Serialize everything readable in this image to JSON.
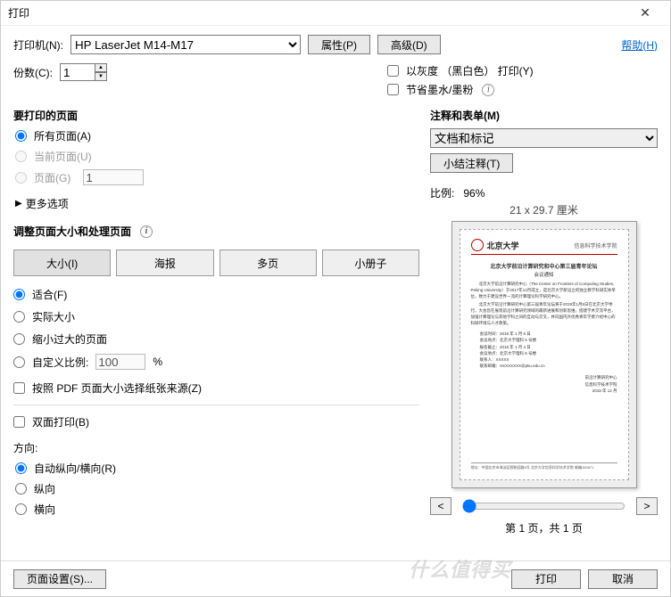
{
  "titlebar": {
    "title": "打印"
  },
  "header": {
    "printer_label": "打印机(N):",
    "printer_selected": "HP LaserJet M14-M17",
    "properties_btn": "属性(P)",
    "advanced_btn": "高级(D)",
    "help_link": "帮助(H)"
  },
  "copies": {
    "label": "份数(C):",
    "value": "1"
  },
  "options": {
    "grayscale": "以灰度 （黑白色） 打印(Y)",
    "save_ink": "节省墨水/墨粉"
  },
  "pages_section": {
    "title": "要打印的页面",
    "all": "所有页面(A)",
    "current": "当前页面(U)",
    "page_label": "页面(G)",
    "page_from_value": "1",
    "more": "更多选项"
  },
  "resize_section": {
    "title": "调整页面大小和处理页面",
    "tabs": {
      "size": "大小(I)",
      "poster": "海报",
      "multi": "多页",
      "booklet": "小册子"
    },
    "fit": "适合(F)",
    "actual": "实际大小",
    "shrink": "缩小过大的页面",
    "custom": "自定义比例:",
    "custom_value": "100",
    "percent": "%",
    "choose_source": "按照 PDF 页面大小选择纸张来源(Z)"
  },
  "duplex": {
    "label": "双面打印(B)"
  },
  "orientation": {
    "label": "方向:",
    "auto": "自动纵向/横向(R)",
    "portrait": "纵向",
    "landscape": "横向"
  },
  "comments": {
    "title": "注释和表单(M)",
    "dropdown_selected": "文档和标记",
    "summarize_btn": "小结注释(T)"
  },
  "preview": {
    "scale_label": "比例:",
    "scale_value": "96%",
    "dimensions": "21 x 29.7 厘米",
    "page_indicator": "第 1 页，共 1 页",
    "doc": {
      "university": "北京大学",
      "institute": "信息科学技术学院",
      "title": "北京大学前沿计算研究和中心第三届青年论坛",
      "subtitle": "会议通知"
    }
  },
  "footer": {
    "page_setup": "页面设置(S)...",
    "print": "打印",
    "cancel": "取消",
    "watermark": "什么值得买"
  }
}
